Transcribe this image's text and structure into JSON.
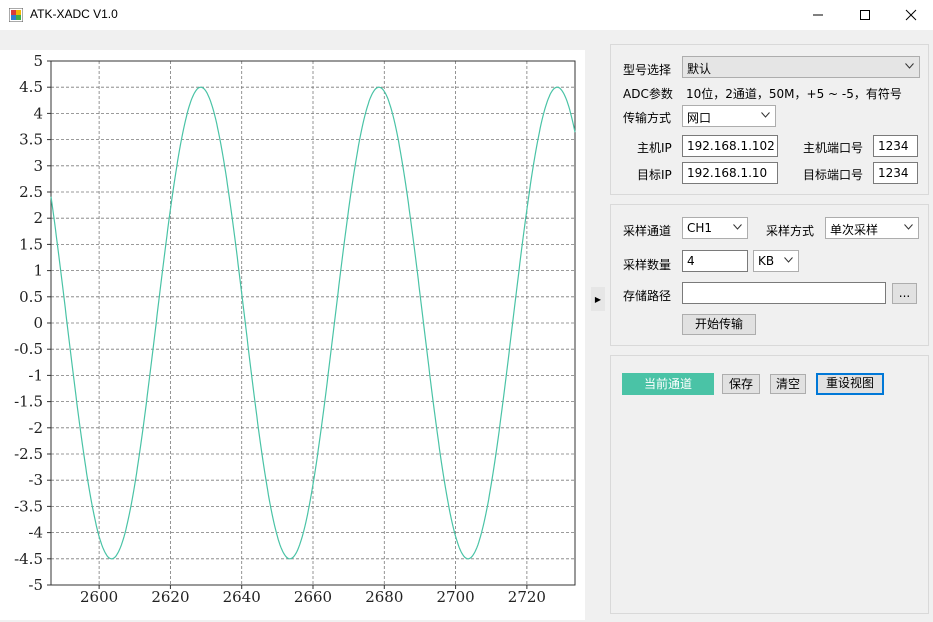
{
  "window": {
    "title": "ATK-XADC V1.0"
  },
  "config": {
    "model_label": "型号选择",
    "model_value": "默认",
    "adc_label": "ADC参数",
    "adc_value": "10位，2通道，50M，+5 ~ -5，有符号",
    "transfer_label": "传输方式",
    "transfer_value": "网口",
    "host_ip_label": "主机IP",
    "host_ip": "192.168.1.102",
    "host_port_label": "主机端口号",
    "host_port": "1234",
    "target_ip_label": "目标IP",
    "target_ip": "192.168.1.10",
    "target_port_label": "目标端口号",
    "target_port": "1234"
  },
  "sampling": {
    "channel_label": "采样通道",
    "channel_value": "CH1",
    "mode_label": "采样方式",
    "mode_value": "单次采样",
    "count_label": "采样数量",
    "count_value": "4",
    "unit_value": "KB",
    "path_label": "存储路径",
    "path_value": "",
    "browse_label": "...",
    "start_label": "开始传输"
  },
  "actions": {
    "current_channel": "当前通道",
    "save": "保存",
    "clear": "清空",
    "reset_view": "重设视图"
  },
  "colors": {
    "trace": "#4ac3a6",
    "accent": "#0078d7"
  },
  "chart_data": {
    "type": "line",
    "x_range": [
      2586.5,
      2733.5
    ],
    "ylim": [
      -5,
      5
    ],
    "y_ticks": [
      5,
      4.5,
      4,
      3.5,
      3,
      2.5,
      2,
      1.5,
      1,
      0.5,
      0,
      -0.5,
      -1,
      -1.5,
      -2,
      -2.5,
      -3,
      -3.5,
      -4,
      -4.5,
      -5
    ],
    "y_tick_labels": [
      "5",
      "4.5",
      "4",
      "3.5",
      "3",
      "2.5",
      "2",
      "1.5",
      "1",
      "0.5",
      "0",
      "-0.5",
      "-1",
      "-1.5",
      "-2",
      "-2.5",
      "-3",
      "-3.5",
      "-4",
      "-4.5",
      "-5"
    ],
    "x_ticks": [
      2600,
      2620,
      2640,
      2660,
      2680,
      2700,
      2720
    ],
    "x_tick_labels": [
      "2600",
      "2620",
      "2640",
      "2660",
      "2680",
      "2700",
      "2720"
    ],
    "grid": true,
    "series": [
      {
        "amplitude": 4.5,
        "period": 50,
        "minima_x": [
          2603.5,
          2653.5,
          2703.5
        ],
        "maxima_x": [
          2628.5,
          2678.5,
          2728.5
        ]
      }
    ]
  }
}
